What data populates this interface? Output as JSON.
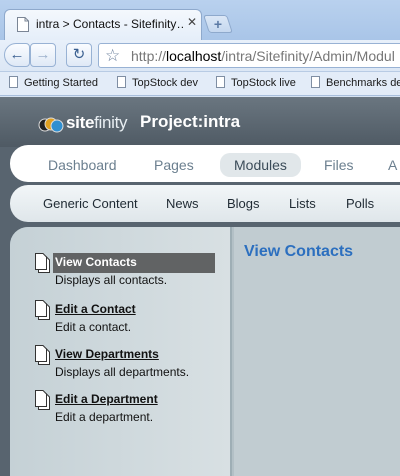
{
  "browser": {
    "tab_title": "intra > Contacts - Sitefinity…",
    "tab_close": "✕",
    "new_tab": "+",
    "url_prefix": "http://",
    "url_host": "localhost",
    "url_path": "/intra/Sitefinity/Admin/Modul",
    "bookmarks": [
      "Getting Started",
      "TopStock dev",
      "TopStock live",
      "Benchmarks de"
    ]
  },
  "header": {
    "logo_site": "site",
    "logo_finity": "finity",
    "project": "Project:intra"
  },
  "main_nav": [
    {
      "label": "Dashboard",
      "active": false
    },
    {
      "label": "Pages",
      "active": false
    },
    {
      "label": "Modules",
      "active": true
    },
    {
      "label": "Files",
      "active": false
    },
    {
      "label": "A",
      "active": false
    }
  ],
  "sub_nav": [
    "Generic Content",
    "News",
    "Blogs",
    "Lists",
    "Polls"
  ],
  "commands": [
    {
      "label": "View Contacts",
      "desc": "Displays all contacts.",
      "selected": true
    },
    {
      "label": "Edit a Contact",
      "desc": "Edit a contact.",
      "selected": false
    },
    {
      "label": "View Departments",
      "desc": "Displays all departments.",
      "selected": false
    },
    {
      "label": "Edit a Department",
      "desc": "Edit a department.",
      "selected": false
    }
  ],
  "view_title": "View Contacts",
  "colors": {
    "accent": "#2c6fbf",
    "header": "#58646f",
    "selected": "#616364"
  }
}
